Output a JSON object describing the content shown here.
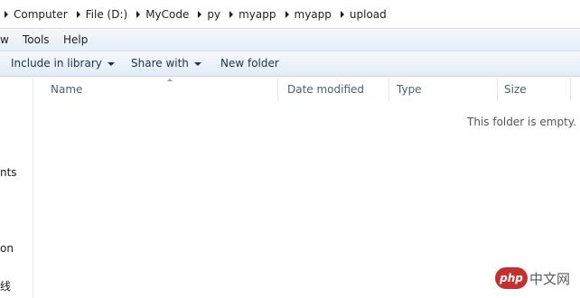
{
  "breadcrumb": [
    "Computer",
    "File (D:)",
    "MyCode",
    "py",
    "myapp",
    "myapp",
    "upload"
  ],
  "menu": {
    "view": "w",
    "tools": "Tools",
    "help": "Help"
  },
  "toolbar": {
    "include_in_library": "Include in library",
    "share_with": "Share with",
    "new_folder": "New folder"
  },
  "nav_pane": {
    "item1": "nts",
    "item2": "on",
    "item3": "线"
  },
  "columns": {
    "name": "Name",
    "date_modified": "Date modified",
    "type": "Type",
    "size": "Size"
  },
  "empty_message": "This folder is empty.",
  "watermark": {
    "logo_text": "php",
    "site": "中文网"
  }
}
